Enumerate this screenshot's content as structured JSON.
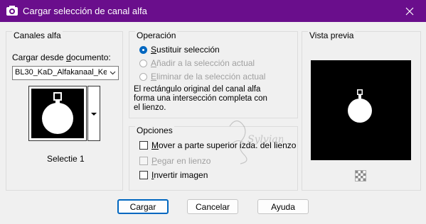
{
  "window": {
    "title": "Cargar selección de canal alfa"
  },
  "alpha_channels": {
    "group_title": "Canales alfa",
    "load_from_label_pre": "Cargar desde ",
    "load_from_label_u": "d",
    "load_from_label_post": "ocumento:",
    "document_value": "BL30_KaD_Alfakanaal_Ker",
    "selected_channel": "Selectie 1"
  },
  "operation": {
    "group_title": "Operación",
    "options": [
      {
        "u": "S",
        "rest": "ustituir selección",
        "selected": true,
        "enabled": true
      },
      {
        "u": "A",
        "rest": "ñadir a la selección actual",
        "selected": false,
        "enabled": false
      },
      {
        "u": "E",
        "rest": "liminar de la selección actual",
        "selected": false,
        "enabled": false
      }
    ],
    "description_lines": [
      "El rectángulo original del canal alfa",
      "forma una intersección completa con",
      "el lienzo."
    ]
  },
  "options": {
    "group_title": "Opciones",
    "items": [
      {
        "u": "M",
        "rest": "over a parte superior izda. del lienzo",
        "checked": false,
        "enabled": true
      },
      {
        "u": "P",
        "rest": "egar en lienzo",
        "checked": false,
        "enabled": false
      },
      {
        "u": "I",
        "rest": "nvertir imagen",
        "checked": false,
        "enabled": true
      }
    ]
  },
  "preview": {
    "group_title": "Vista previa"
  },
  "buttons": {
    "load": "Cargar",
    "cancel": "Cancelar",
    "help": "Ayuda"
  },
  "watermark": "Sylviane"
}
